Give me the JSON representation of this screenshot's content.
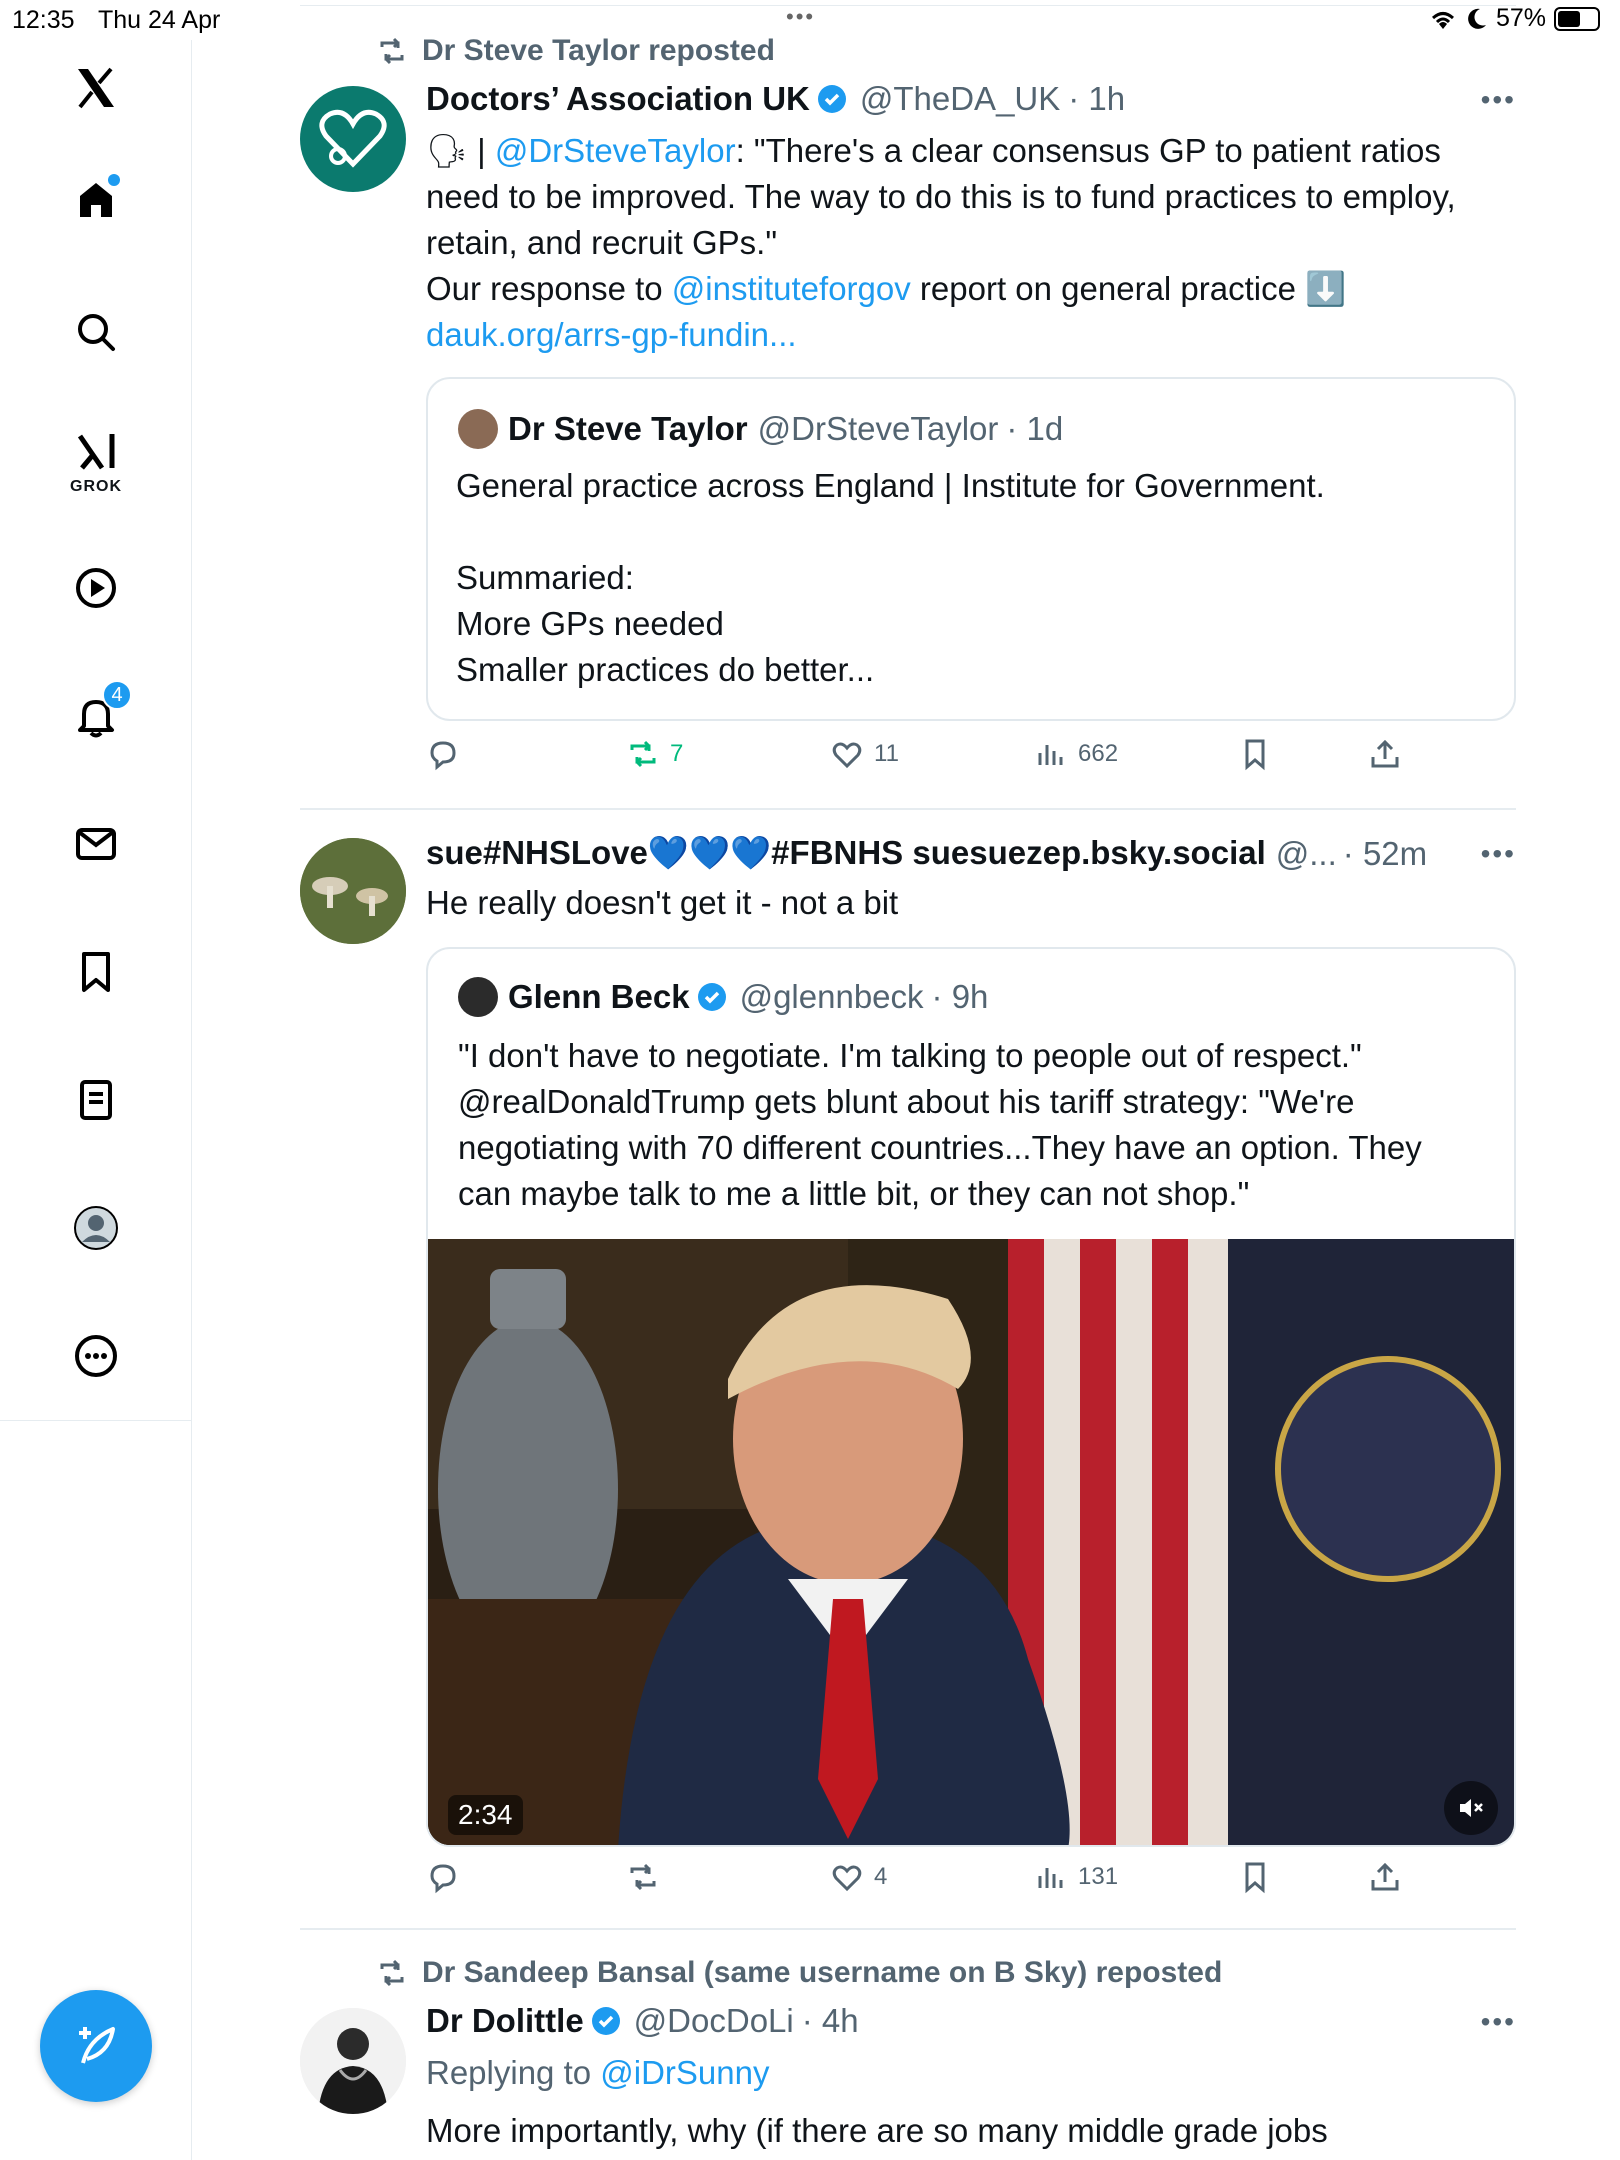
{
  "status_bar": {
    "time": "12:35",
    "date": "Thu 24 Apr",
    "battery": "57%",
    "battery_level": 0.57
  },
  "sidebar": {
    "grok_label": "GROK",
    "notifications_badge": "4"
  },
  "posts": [
    {
      "repost_by": "Dr Steve Taylor reposted",
      "name": "Doctors’ Association UK",
      "handle": "@TheDA_UK",
      "time": "· 1h",
      "text": {
        "emoji": "🗣",
        "sep": " | ",
        "mention": "@DrSteveTaylor",
        "quote": ": \"There's a clear consensus GP to patient ratios need to be improved. The way to do this is to fund practices to employ, retain, and recruit GPs.\"",
        "line2_pre": "Our response to ",
        "line2_mention": "@instituteforgov",
        "line2_post": " report on general practice ",
        "arrow": "⬇️",
        "url": "dauk.org/arrs-gp-fundin..."
      },
      "quoted": {
        "name": "Dr Steve Taylor",
        "handle": "@DrSteveTaylor",
        "time": "· 1d",
        "line1": "General practice across England | Institute for Government.",
        "line2": "Summaried:",
        "line3": "More GPs needed",
        "line4": "Smaller practices do better..."
      },
      "stats": {
        "replies": "",
        "reposts": "7",
        "likes": "11",
        "views": "662"
      }
    },
    {
      "name": "sue#NHSLove💙💙💙#FBNHS suesuezep.bsky.social",
      "handle": "@...",
      "time": "· 52m",
      "text": "He really doesn't get it - not a bit",
      "quoted": {
        "name": "Glenn Beck",
        "handle": "@glennbeck",
        "time": "· 9h",
        "text": "\"I don't have to negotiate. I'm talking to people out of respect.\" @realDonaldTrump gets blunt about his tariff strategy: \"We're negotiating with 70 different countries...They have an option. They can maybe talk to me a little bit, or they can not shop.\"",
        "video_duration": "2:34"
      },
      "stats": {
        "replies": "",
        "reposts": "",
        "likes": "4",
        "views": "131"
      }
    },
    {
      "repost_by": "Dr Sandeep Bansal (same username on B Sky) reposted",
      "name": "Dr Dolittle",
      "handle": "@DocDoLi",
      "time": "· 4h",
      "replying_label": "Replying to ",
      "replying_to": "@iDrSunny",
      "text": "More importantly, why (if there are so many middle grade jobs"
    }
  ],
  "colors": {
    "accent": "#1d9bf0",
    "repost_green": "#00ba7c",
    "secondary_text": "#536471",
    "dauk_teal": "#0b7a6e"
  }
}
